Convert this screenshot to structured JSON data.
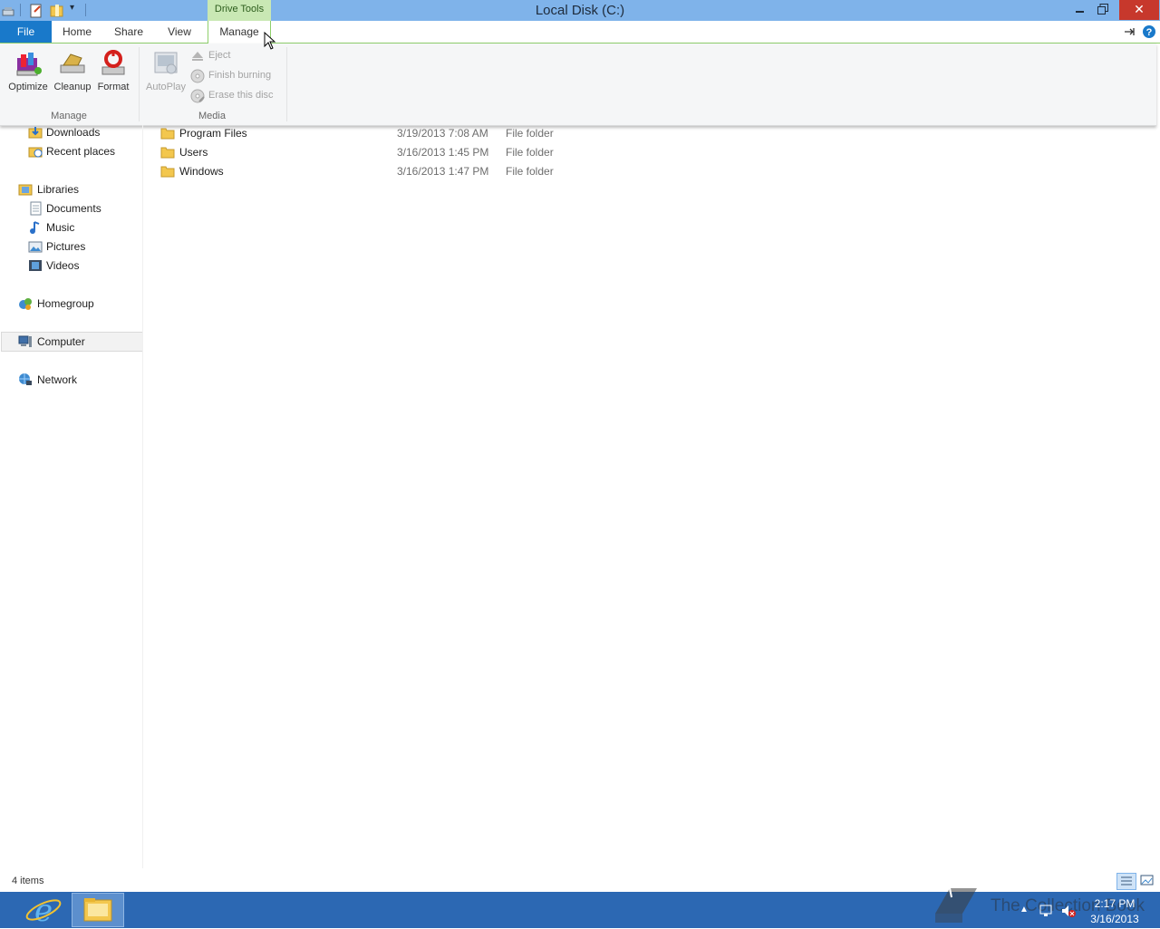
{
  "window": {
    "title": "Local Disk (C:)",
    "context_tab_group": "Drive Tools",
    "minimize_glyph": "🗕",
    "restore_glyph": "🗗",
    "close_glyph": "✕"
  },
  "ribbon": {
    "tabs": [
      "File",
      "Home",
      "Share",
      "View",
      "Manage"
    ],
    "active_tab": "Manage",
    "manage_group": {
      "label": "Manage",
      "buttons": [
        "Optimize",
        "Cleanup",
        "Format"
      ]
    },
    "media_group": {
      "label": "Media",
      "autoplay_label": "AutoPlay",
      "small_buttons": [
        "Eject",
        "Finish burning",
        "Erase this disc"
      ]
    }
  },
  "nav_pane": {
    "items": [
      {
        "label": "Downloads",
        "icon": "downloads-icon"
      },
      {
        "label": "Recent places",
        "icon": "recent-places-icon"
      },
      {
        "label": "Libraries",
        "icon": "libraries-icon"
      },
      {
        "label": "Documents",
        "icon": "documents-icon"
      },
      {
        "label": "Music",
        "icon": "music-icon"
      },
      {
        "label": "Pictures",
        "icon": "pictures-icon"
      },
      {
        "label": "Videos",
        "icon": "videos-icon"
      },
      {
        "label": "Homegroup",
        "icon": "homegroup-icon"
      },
      {
        "label": "Computer",
        "icon": "computer-icon"
      },
      {
        "label": "Network",
        "icon": "network-icon"
      }
    ],
    "selected": "Computer"
  },
  "files": [
    {
      "name": "Program Files",
      "date": "3/19/2013 7:08 AM",
      "type": "File folder"
    },
    {
      "name": "Users",
      "date": "3/16/2013 1:45 PM",
      "type": "File folder"
    },
    {
      "name": "Windows",
      "date": "3/16/2013 1:47 PM",
      "type": "File folder"
    }
  ],
  "status": {
    "item_count": "4 items"
  },
  "taskbar": {
    "time": "2:17 PM",
    "date": "3/16/2013",
    "watermark": "The Collection Book"
  },
  "colors": {
    "titlebar": "#7fb3ea",
    "file_tab": "#1979ca",
    "context_tab": "#c9e8b4",
    "taskbar": "#2c68b3",
    "close_button": "#c7382c"
  }
}
